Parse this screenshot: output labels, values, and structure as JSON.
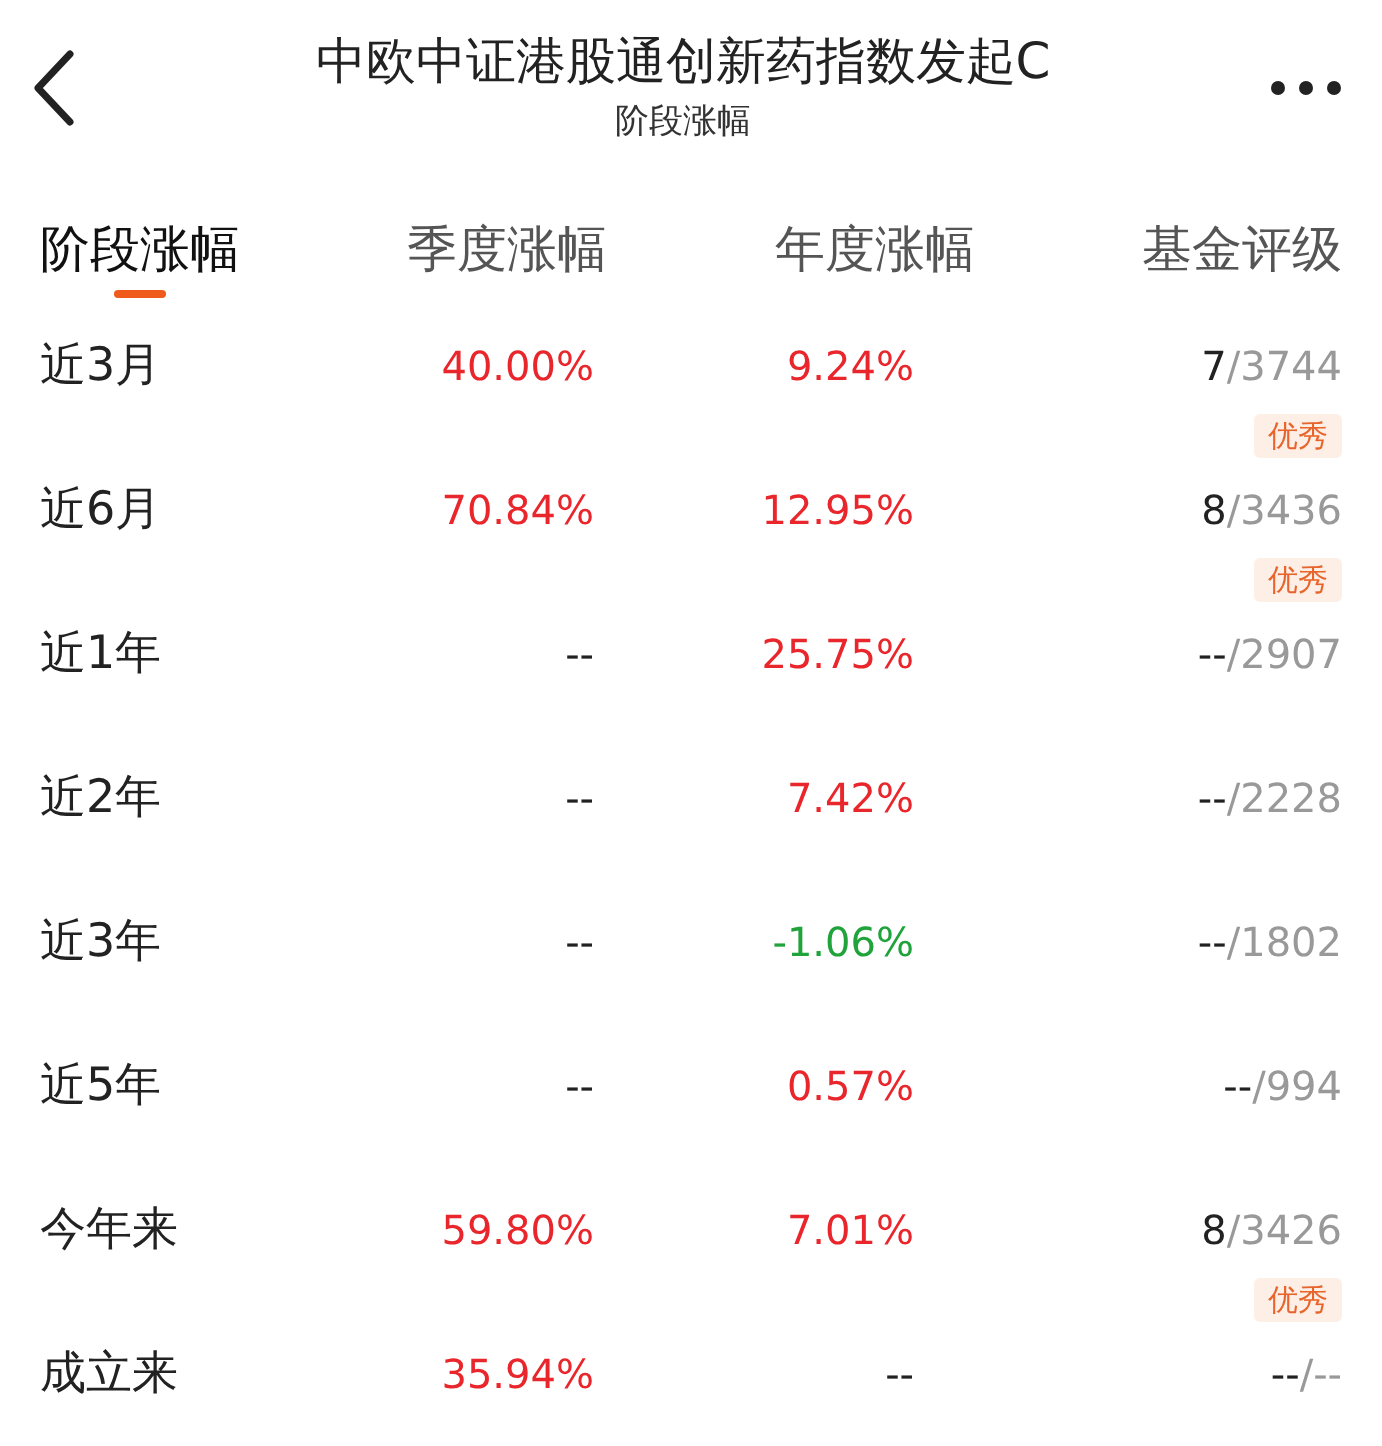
{
  "header": {
    "title": "中欧中证港股通创新药指数发起C",
    "subtitle": "阶段涨幅"
  },
  "tabs": [
    {
      "label": "阶段涨幅",
      "selected": true
    },
    {
      "label": "季度涨幅",
      "selected": false
    },
    {
      "label": "年度涨幅",
      "selected": false
    },
    {
      "label": "基金评级",
      "selected": false
    }
  ],
  "rows": [
    {
      "period": "近3月",
      "column_2": {
        "text": "40.00%",
        "color": "#e8262b"
      },
      "column_3": {
        "text": "9.24%",
        "color": "#e8262b"
      },
      "rating": {
        "rank": "7",
        "total": "/3744",
        "badge": "优秀"
      }
    },
    {
      "period": "近6月",
      "column_2": {
        "text": "70.84%",
        "color": "#e8262b"
      },
      "column_3": {
        "text": "12.95%",
        "color": "#e8262b"
      },
      "rating": {
        "rank": "8",
        "total": "/3436",
        "badge": "优秀"
      }
    },
    {
      "period": "近1年",
      "column_2": {
        "text": "--",
        "color": "#222222"
      },
      "column_3": {
        "text": "25.75%",
        "color": "#e8262b"
      },
      "rating": {
        "rank": "--",
        "total": "/2907"
      }
    },
    {
      "period": "近2年",
      "column_2": {
        "text": "--",
        "color": "#222222"
      },
      "column_3": {
        "text": "7.42%",
        "color": "#e8262b"
      },
      "rating": {
        "rank": "--",
        "total": "/2228"
      }
    },
    {
      "period": "近3年",
      "column_2": {
        "text": "--",
        "color": "#222222"
      },
      "column_3": {
        "text": "-1.06%",
        "color": "#1fa33a"
      },
      "rating": {
        "rank": "--",
        "total": "/1802"
      }
    },
    {
      "period": "近5年",
      "column_2": {
        "text": "--",
        "color": "#222222"
      },
      "column_3": {
        "text": "0.57%",
        "color": "#e8262b"
      },
      "rating": {
        "rank": "--",
        "total": "/994"
      }
    },
    {
      "period": "今年来",
      "column_2": {
        "text": "59.80%",
        "color": "#e8262b"
      },
      "column_3": {
        "text": "7.01%",
        "color": "#e8262b"
      },
      "rating": {
        "rank": "8",
        "total": "/3426",
        "badge": "优秀"
      }
    },
    {
      "period": "成立来",
      "column_2": {
        "text": "35.94%",
        "color": "#e8262b"
      },
      "column_3": {
        "text": "--",
        "color": "#222222"
      },
      "rating": {
        "rank": "--",
        "total": "/--"
      }
    }
  ]
}
